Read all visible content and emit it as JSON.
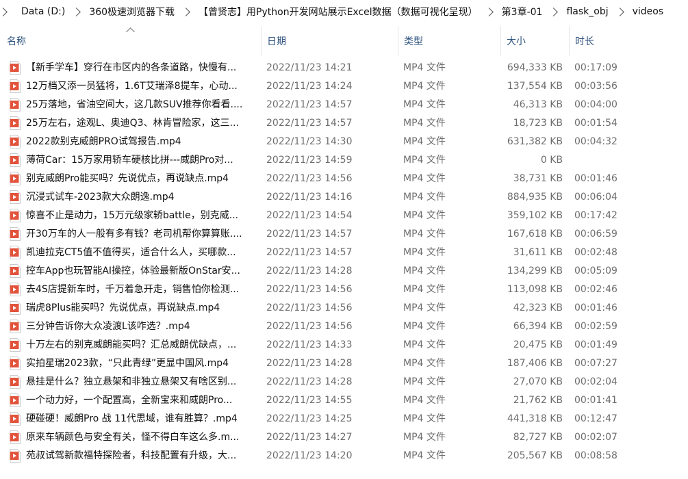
{
  "breadcrumb": [
    "Data (D:)",
    "360极速浏览器下载",
    "【曾贤志】用Python开发网站展示Excel数据（数据可视化呈现）",
    "第3章-01",
    "flask_obj",
    "videos"
  ],
  "columns": {
    "name": "名称",
    "date": "日期",
    "type": "类型",
    "size": "大小",
    "duration": "时长"
  },
  "file_icon": "video-file-icon",
  "accent_colors": {
    "icon_fill": "#e2533c",
    "header_text": "#2a4f7c"
  },
  "files": [
    {
      "name": "【新手学车】穿行在市区内的各条道路，快慢有...",
      "date": "2022/11/23 14:21",
      "type": "MP4 文件",
      "size": "694,333 KB",
      "duration": "00:17:09"
    },
    {
      "name": "12万档又添一员猛将，1.6T艾瑞泽8提车，心动...",
      "date": "2022/11/23 14:24",
      "type": "MP4 文件",
      "size": "137,554 KB",
      "duration": "00:03:56"
    },
    {
      "name": "25万落地，省油空间大，这几款SUV推荐你看看....",
      "date": "2022/11/23 14:57",
      "type": "MP4 文件",
      "size": "46,313 KB",
      "duration": "00:04:00"
    },
    {
      "name": "25万左右，途观L、奥迪Q3、林肯冒险家，这三...",
      "date": "2022/11/23 14:57",
      "type": "MP4 文件",
      "size": "18,723 KB",
      "duration": "00:01:54"
    },
    {
      "name": "2022款别克威朗PRO试驾报告.mp4",
      "date": "2022/11/23 14:30",
      "type": "MP4 文件",
      "size": "631,382 KB",
      "duration": "00:04:32"
    },
    {
      "name": "薄荷Car：15万家用轿车硬核比拼---威朗Pro对...",
      "date": "2022/11/23 14:59",
      "type": "MP4 文件",
      "size": "0 KB",
      "duration": ""
    },
    {
      "name": "别克威朗Pro能买吗？先说优点，再说缺点.mp4",
      "date": "2022/11/23 14:56",
      "type": "MP4 文件",
      "size": "38,731 KB",
      "duration": "00:01:46"
    },
    {
      "name": "沉浸式试车-2023款大众朗逸.mp4",
      "date": "2022/11/23 14:16",
      "type": "MP4 文件",
      "size": "884,935 KB",
      "duration": "00:06:04"
    },
    {
      "name": "惊喜不止是动力，15万元级家轿battle，别克威...",
      "date": "2022/11/23 14:54",
      "type": "MP4 文件",
      "size": "359,102 KB",
      "duration": "00:17:42"
    },
    {
      "name": "开30万车的人一般有多有钱？老司机帮你算算账....",
      "date": "2022/11/23 14:57",
      "type": "MP4 文件",
      "size": "167,618 KB",
      "duration": "00:06:59"
    },
    {
      "name": "凯迪拉克CT5值不值得买，适合什么人，买哪款...",
      "date": "2022/11/23 14:57",
      "type": "MP4 文件",
      "size": "31,611 KB",
      "duration": "00:02:48"
    },
    {
      "name": "控车App也玩智能AI操控，体验最新版OnStar安...",
      "date": "2022/11/23 14:28",
      "type": "MP4 文件",
      "size": "134,299 KB",
      "duration": "00:05:09"
    },
    {
      "name": "去4S店提新车时，千万着急开走，销售怕你检测...",
      "date": "2022/11/23 14:56",
      "type": "MP4 文件",
      "size": "113,098 KB",
      "duration": "00:02:46"
    },
    {
      "name": "瑞虎8Plus能买吗？先说优点，再说缺点.mp4",
      "date": "2022/11/23 14:56",
      "type": "MP4 文件",
      "size": "42,323 KB",
      "duration": "00:01:46"
    },
    {
      "name": "三分钟告诉你大众凌渡L该咋选？.mp4",
      "date": "2022/11/23 14:56",
      "type": "MP4 文件",
      "size": "66,394 KB",
      "duration": "00:02:59"
    },
    {
      "name": "十万左右的别克威朗能买吗？汇总威朗优缺点，...",
      "date": "2022/11/23 14:33",
      "type": "MP4 文件",
      "size": "20,475 KB",
      "duration": "00:01:49"
    },
    {
      "name": "实拍星瑞2023款，“只此青绿”更显中国风.mp4",
      "date": "2022/11/23 14:28",
      "type": "MP4 文件",
      "size": "187,406 KB",
      "duration": "00:07:27"
    },
    {
      "name": "悬挂是什么？独立悬架和非独立悬架又有啥区别...",
      "date": "2022/11/23 14:28",
      "type": "MP4 文件",
      "size": "27,070 KB",
      "duration": "00:02:04"
    },
    {
      "name": "一个动力好，一个配置高，全新宝来和威朗Pro...",
      "date": "2022/11/23 14:55",
      "type": "MP4 文件",
      "size": "21,762 KB",
      "duration": "00:01:41"
    },
    {
      "name": "硬碰硬！威朗Pro 战 11代思域，谁有胜算？.mp4",
      "date": "2022/11/23 14:25",
      "type": "MP4 文件",
      "size": "441,318 KB",
      "duration": "00:12:47"
    },
    {
      "name": "原来车辆颜色与安全有关，怪不得白车这么多.m...",
      "date": "2022/11/23 14:27",
      "type": "MP4 文件",
      "size": "82,727 KB",
      "duration": "00:02:07"
    },
    {
      "name": "苑叔试驾新款福特探险者，科技配置有升级，大...",
      "date": "2022/11/23 14:20",
      "type": "MP4 文件",
      "size": "205,567 KB",
      "duration": "00:08:58"
    }
  ]
}
